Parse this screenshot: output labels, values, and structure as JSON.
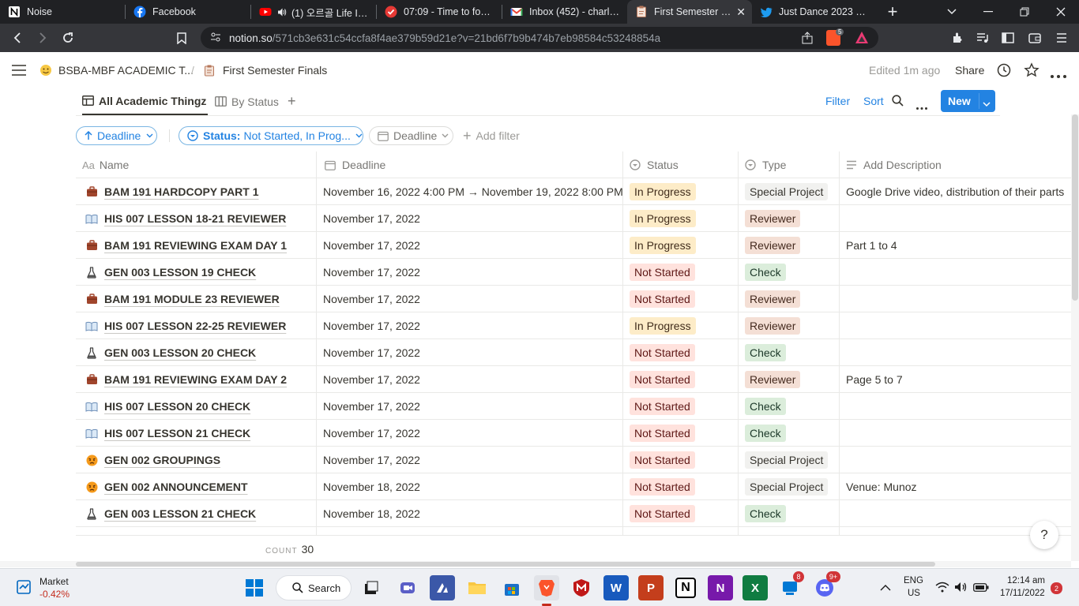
{
  "browser": {
    "tabs": [
      {
        "label": "Noise",
        "icon": "notion-icon",
        "color": "#ffffff",
        "active": false
      },
      {
        "label": "Facebook",
        "icon": "facebook-icon",
        "color": "#1877f2",
        "active": false
      },
      {
        "label": "(1) 오르골 Life Is St",
        "icon": "youtube-icon",
        "color": "#ff0000",
        "active": false
      },
      {
        "label": "07:09 - Time to focus!",
        "icon": "pomodoro-icon",
        "color": "#e53935",
        "active": false
      },
      {
        "label": "Inbox (452) - charlesjo",
        "icon": "gmail-icon",
        "color": "#ea4335",
        "active": false
      },
      {
        "label": "First Semester Fina",
        "icon": "notion-page-icon",
        "color": "#ffffff",
        "active": true
      },
      {
        "label": "Just Dance 2023 Editio",
        "icon": "twitter-icon",
        "color": "#1d9bf0",
        "active": false
      }
    ],
    "url_host": "notion.so",
    "url_path": "/571cb3e631c54ccfa8f4ae379b59d21e?v=21bd6f7b9b474b7eb98584c53248854a",
    "brave_badge": "5"
  },
  "notion": {
    "workspace": "BSBA-MBF ACADEMIC T...",
    "page": "First Semester Finals",
    "edited": "Edited 1m ago",
    "share": "Share",
    "views": [
      "All Academic Thingz",
      "By Status"
    ],
    "filter": "Filter",
    "sort": "Sort",
    "new": "New",
    "chips": {
      "sort_chip": "Deadline",
      "status_label": "Status:",
      "status_value": "Not Started, In Prog...",
      "deadline_chip": "Deadline",
      "add_filter": "Add filter"
    },
    "columns": {
      "name": "Name",
      "name_prefix": "Aa",
      "deadline": "Deadline",
      "status": "Status",
      "type": "Type",
      "description": "Add Description"
    },
    "rows": [
      {
        "name": "BAM 191 HARDCOPY PART 1",
        "icon": "briefcase-icon",
        "deadline": "November 16, 2022 4:00 PM → November 19, 2022 8:00 PM",
        "status": "In Progress",
        "type": "Special Project",
        "desc": "Google Drive video, distribution of their parts"
      },
      {
        "name": "HIS 007 LESSON 18-21 REVIEWER",
        "icon": "book-icon",
        "deadline": "November 17, 2022",
        "status": "In Progress",
        "type": "Reviewer",
        "desc": ""
      },
      {
        "name": "BAM 191 REVIEWING EXAM DAY 1",
        "icon": "briefcase-icon",
        "deadline": "November 17, 2022",
        "status": "In Progress",
        "type": "Reviewer",
        "desc": "Part 1 to 4"
      },
      {
        "name": "GEN 003 LESSON 19 CHECK",
        "icon": "flask-icon",
        "deadline": "November 17, 2022",
        "status": "Not Started",
        "type": "Check",
        "desc": ""
      },
      {
        "name": "BAM 191 MODULE 23 REVIEWER",
        "icon": "briefcase-icon",
        "deadline": "November 17, 2022",
        "status": "Not Started",
        "type": "Reviewer",
        "desc": ""
      },
      {
        "name": "HIS 007 LESSON 22-25 REVIEWER",
        "icon": "book-icon",
        "deadline": "November 17, 2022",
        "status": "In Progress",
        "type": "Reviewer",
        "desc": ""
      },
      {
        "name": "GEN 003 LESSON 20 CHECK",
        "icon": "flask-icon",
        "deadline": "November 17, 2022",
        "status": "Not Started",
        "type": "Check",
        "desc": ""
      },
      {
        "name": "BAM 191 REVIEWING EXAM DAY 2",
        "icon": "briefcase-icon",
        "deadline": "November 17, 2022",
        "status": "Not Started",
        "type": "Reviewer",
        "desc": "Page 5 to 7"
      },
      {
        "name": "HIS 007 LESSON 20 CHECK",
        "icon": "book-icon",
        "deadline": "November 17, 2022",
        "status": "Not Started",
        "type": "Check",
        "desc": ""
      },
      {
        "name": "HIS 007 LESSON 21 CHECK",
        "icon": "book-icon",
        "deadline": "November 17, 2022",
        "status": "Not Started",
        "type": "Check",
        "desc": ""
      },
      {
        "name": "GEN 002 GROUPINGS",
        "icon": "angry-face-icon",
        "deadline": "November 17, 2022",
        "status": "Not Started",
        "type": "Special Project",
        "desc": ""
      },
      {
        "name": "GEN 002 ANNOUNCEMENT",
        "icon": "angry-face-icon",
        "deadline": "November 18, 2022",
        "status": "Not Started",
        "type": "Special Project",
        "desc": "Venue: Munoz"
      },
      {
        "name": "GEN 003 LESSON 21 CHECK",
        "icon": "flask-icon",
        "deadline": "November 18, 2022",
        "status": "Not Started",
        "type": "Check",
        "desc": ""
      }
    ],
    "count_label": "COUNT",
    "count_value": "30",
    "help": "?"
  },
  "taskbar": {
    "widget_title": "Market",
    "widget_value": "-0.42%",
    "search": "Search",
    "lang": "ENG",
    "region": "US",
    "time": "12:14 am",
    "date": "17/11/2022",
    "notif_count": "2",
    "teams_badge": "8",
    "discord_badge": "9+"
  },
  "colors": {
    "accent_blue": "#2383e2",
    "in_progress_bg": "#fdecc8",
    "not_started_bg": "#ffe2dd",
    "reviewer_bg": "#f4dfd5",
    "check_bg": "#dbeddb",
    "special_bg": "#f1f1ef"
  }
}
